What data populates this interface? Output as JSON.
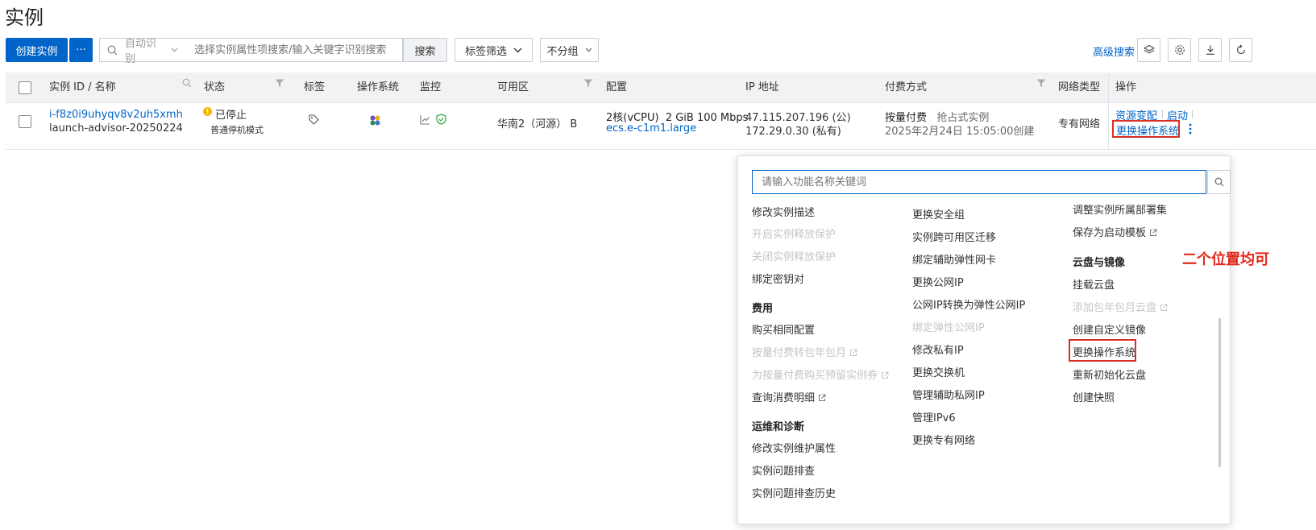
{
  "page": {
    "title": "实例"
  },
  "toolbar": {
    "create_label": "创建实例",
    "more_label": "···",
    "search_scope": "自动识别",
    "search_placeholder": "选择实例属性项搜索/输入关键字识别搜索",
    "search_button": "搜索",
    "tag_filter": "标签筛选",
    "group_select": "不分组",
    "advanced_search": "高级搜索"
  },
  "table": {
    "columns": [
      "实例 ID / 名称",
      "状态",
      "标签",
      "操作系统",
      "监控",
      "可用区",
      "配置",
      "IP 地址",
      "付费方式",
      "网络类型",
      "操作"
    ],
    "row": {
      "instance_id": "i-f8z0i9uhyqv8v2uh5xmh",
      "instance_name": "launch-advisor-20250224",
      "status": "已停止",
      "stop_mode": "普通停机模式",
      "zone": "华南2（河源） B",
      "config_cpu": "2核(vCPU)",
      "config_mem": "2 GiB 100 Mbps",
      "config_type": "ecs.e-c1m1.large",
      "ip_public": "47.115.207.196 (公)",
      "ip_private": "172.29.0.30 (私有)",
      "pay_type": "按量付费",
      "pay_extra": "抢占式实例",
      "created": "2025年2月24日 15:05:00创建",
      "network": "专有网络",
      "action_change_config": "资源变配",
      "action_start": "启动",
      "action_change_os": "更换操作系统"
    }
  },
  "dropdown": {
    "search_placeholder": "请输入功能名称关键词",
    "col1": {
      "items_top": [
        "修改实例描述",
        "开启实例释放保护",
        "关闭实例释放保护",
        "绑定密钥对"
      ],
      "fee_head": "费用",
      "fee_items": [
        "购买相同配置",
        "按量付费转包年包月",
        "为按量付费购买预留实例券",
        "查询消费明细"
      ],
      "ops_head": "运维和诊断",
      "ops_items": [
        "修改实例维护属性",
        "实例问题排查",
        "实例问题排查历史"
      ]
    },
    "col2": {
      "items": [
        "更换安全组",
        "实例跨可用区迁移",
        "绑定辅助弹性网卡",
        "更换公网IP",
        "公网IP转换为弹性公网IP",
        "绑定弹性公网IP",
        "修改私有IP",
        "更换交换机",
        "管理辅助私网IP",
        "管理IPv6",
        "更换专有网络"
      ]
    },
    "col3": {
      "items_top": [
        "调整实例所属部署集",
        "保存为启动模板"
      ],
      "disk_head": "云盘与镜像",
      "disk_items": [
        "挂载云盘",
        "添加包年包月云盘",
        "创建自定义镜像",
        "更换操作系统",
        "重新初始化云盘",
        "创建快照"
      ]
    }
  },
  "annotation": {
    "text": "二个位置均可",
    "color": "#e0281d"
  },
  "colors": {
    "primary": "#0064c8",
    "warning": "#f5b400",
    "highlight": "#d93026"
  }
}
